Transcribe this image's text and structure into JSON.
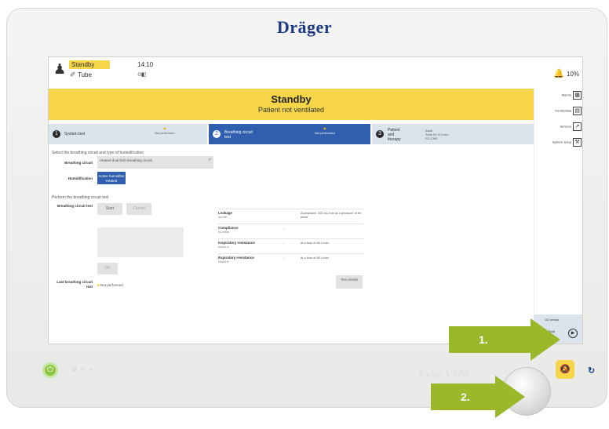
{
  "brand": "Dräger",
  "model": "Evita V800",
  "header": {
    "mode": "Standby",
    "time": "14:10",
    "airway": "Tube",
    "battery": "⊙▮▯",
    "alarm_volume": "10%"
  },
  "banner": {
    "title": "Standby",
    "subtitle": "Patient not ventilated"
  },
  "steps": [
    {
      "num": "1",
      "label": "System test",
      "status": "Not performed"
    },
    {
      "num": "2",
      "label": "Breathing circuit test",
      "status": "Not performed"
    },
    {
      "num": "3",
      "label": "Patient and therapy",
      "details": [
        "Adult",
        "Tube ID: 8.0 mm",
        "PC-CMV"
      ]
    }
  ],
  "main": {
    "select_heading": "Select the breathing circuit and type of humidification",
    "breathing_circuit_label": "Breathing circuit",
    "breathing_circuit_value": "Heated dual limb breathing circuit",
    "humidification_label": "Humidification",
    "humidification_value": "Active humidifier  Heated",
    "perform_heading": "Perform the breathing circuit test",
    "test_label": "Breathing circuit test",
    "start_label": "Start",
    "cancel_label": "Cancel",
    "ok_label": "OK",
    "last_test_label": "Last breathing circuit test",
    "last_test_value": "Not performed",
    "results": [
      {
        "name": "Leakage",
        "unit": "mL/min",
        "value": "",
        "note": "Acceptable: 300 mL/min at a pressure of 60 mbar"
      },
      {
        "name": "Compliance",
        "unit": "mL/mbar",
        "value": "---",
        "note": ""
      },
      {
        "name": "Inspiratory resistance",
        "unit": "mbar/L/s",
        "value": "---",
        "note": "at a flow of 60 L/min"
      },
      {
        "name": "Expiratory resistance",
        "unit": "mbar/L/s",
        "value": "---",
        "note": "at a flow of 60 L/min"
      }
    ],
    "test_details_label": "Test details"
  },
  "right_panel": {
    "buttons": [
      "Alarms",
      "Trends/data",
      "Sensors",
      "System setup"
    ],
    "o2_sensor": "O2 sensor",
    "start_ventilation": "Start/ Start ventilation"
  },
  "device_bottom": {
    "controls": "⊙  ☼  ☼"
  },
  "callouts": [
    "1.",
    "2."
  ],
  "colors": {
    "banner": "#f6d548",
    "step_active": "#2f5fae",
    "brand": "#1d3a86",
    "callout": "#9bb72a",
    "power": "#8cc63f"
  }
}
